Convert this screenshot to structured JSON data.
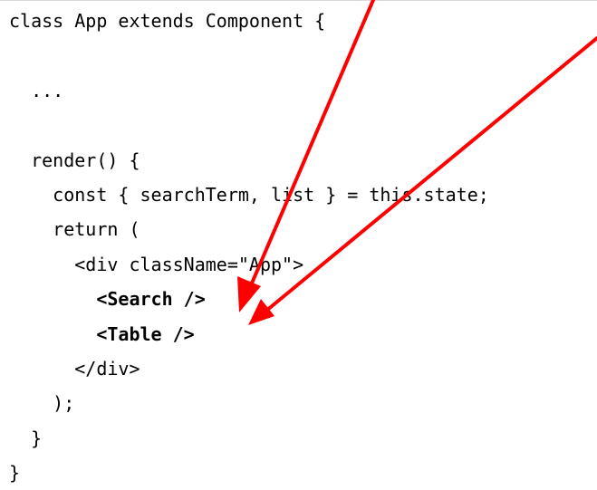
{
  "code": {
    "lines": [
      {
        "text": "class App extends Component {",
        "bold": false
      },
      {
        "text": "",
        "bold": false
      },
      {
        "text": "  ...",
        "bold": false
      },
      {
        "text": "",
        "bold": false
      },
      {
        "text": "  render() {",
        "bold": false
      },
      {
        "text": "    const { searchTerm, list } = this.state;",
        "bold": false
      },
      {
        "text": "    return (",
        "bold": false
      },
      {
        "text": "      <div className=\"App\">",
        "bold": false
      },
      {
        "text": "        <Search />",
        "bold": true
      },
      {
        "text": "        <Table />",
        "bold": true
      },
      {
        "text": "      </div>",
        "bold": false
      },
      {
        "text": "    );",
        "bold": false
      },
      {
        "text": "  }",
        "bold": false
      },
      {
        "text": "}",
        "bold": false
      }
    ]
  },
  "annotations": {
    "arrow_color": "#ff0000",
    "arrows": [
      {
        "name": "arrow-to-search",
        "points_to": "<Search />"
      },
      {
        "name": "arrow-to-table",
        "points_to": "<Table />"
      }
    ]
  }
}
